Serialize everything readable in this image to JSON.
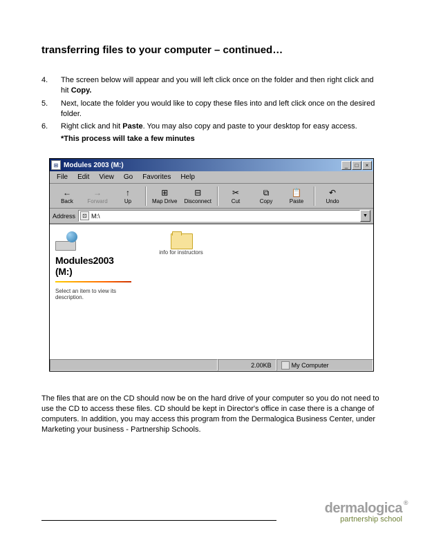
{
  "title": "transferring files to your computer – continued…",
  "steps": [
    {
      "num": "4.",
      "text_pre": "The screen below will appear and you will left click once on the folder and then right click and hit ",
      "bold": "Copy.",
      "text_post": ""
    },
    {
      "num": "5.",
      "text_pre": "Next, locate the folder you would like to copy these files into and left click once on the desired folder.",
      "bold": "",
      "text_post": ""
    },
    {
      "num": "6.",
      "text_pre": "Right click and hit ",
      "bold": "Paste",
      "text_post": ". You may also copy and paste to your desktop for easy access."
    }
  ],
  "note": "*This process will take a few minutes",
  "window": {
    "title": "Modules 2003 (M:)",
    "menu": [
      "File",
      "Edit",
      "View",
      "Go",
      "Favorites",
      "Help"
    ],
    "toolbar": [
      {
        "label": "Back",
        "icon": "←",
        "disabled": false
      },
      {
        "label": "Forward",
        "icon": "→",
        "disabled": true
      },
      {
        "label": "Up",
        "icon": "↑",
        "disabled": false
      },
      {
        "label": "Map Drive",
        "icon": "⊞",
        "disabled": false
      },
      {
        "label": "Disconnect",
        "icon": "⊟",
        "disabled": false
      },
      {
        "label": "Cut",
        "icon": "✂",
        "disabled": false
      },
      {
        "label": "Copy",
        "icon": "⧉",
        "disabled": false
      },
      {
        "label": "Paste",
        "icon": "📋",
        "disabled": false
      },
      {
        "label": "Undo",
        "icon": "↶",
        "disabled": false
      }
    ],
    "address_label": "Address",
    "address_value": "M:\\",
    "drive_title_line1": "Modules2003",
    "drive_title_line2": "(M:)",
    "drive_desc": "Select an item to view its description.",
    "folder_label": "info for instructors",
    "status_size": "2.00KB",
    "status_loc": "My Computer"
  },
  "bodytext": "The files that are on the CD should now be on the hard drive of your computer so you do not need to use the CD to access these files. CD should be kept in Director's office in case there is a change of computers. In addition, you may access this program from the Dermalogica Business Center, under  Marketing your business - Partnership Schools.",
  "brand": {
    "name": "dermalogica",
    "reg": "®",
    "sub": "partnership school"
  }
}
